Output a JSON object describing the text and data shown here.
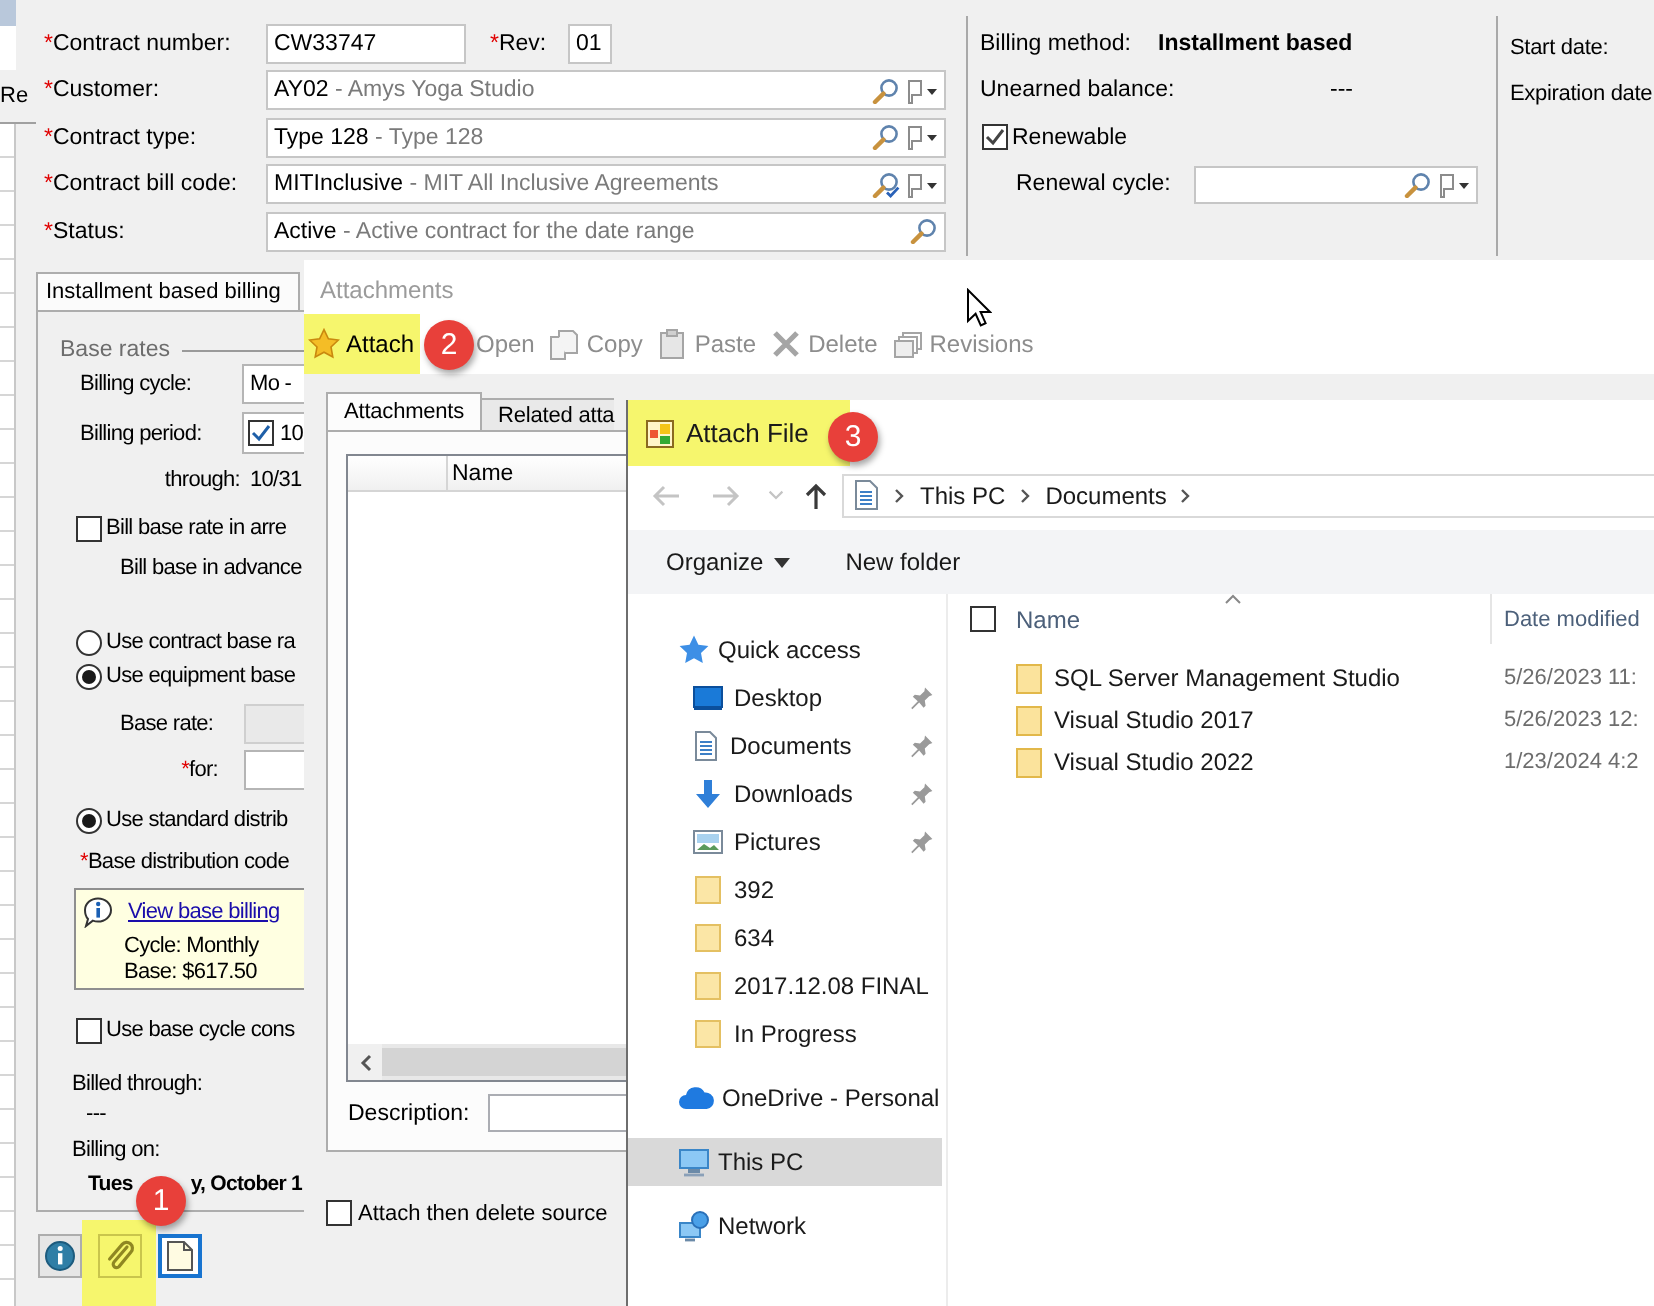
{
  "left_strip": {
    "label": "Re"
  },
  "contract": {
    "number": {
      "mark": "*",
      "label": "Contract number:",
      "value": "CW33747"
    },
    "rev": {
      "mark": "*",
      "label": "Rev:",
      "value": "01"
    },
    "lookup_fields": [
      {
        "mark": "*",
        "label": "Customer:",
        "code": "AY02",
        "description": "- Amys Yoga Studio",
        "validated": false,
        "flag_menu": true
      },
      {
        "mark": "*",
        "label": "Contract type:",
        "code": "Type 128",
        "description": "- Type 128",
        "validated": false,
        "flag_menu": true
      },
      {
        "mark": "*",
        "label": "Contract bill code:",
        "code": "MITInclusive",
        "description": "- MIT All Inclusive Agreements",
        "validated": true,
        "flag_menu": true
      },
      {
        "mark": "*",
        "label": "Status:",
        "code": "Active",
        "description": "- Active contract for the date range",
        "validated": false,
        "flag_menu": false
      }
    ]
  },
  "billing": {
    "method_label": "Billing method:",
    "method": "Installment based",
    "unearned_label": "Unearned balance:",
    "unearned": "---",
    "renewable": {
      "label": "Renewable",
      "checked": true
    },
    "renewal_cycle": {
      "label": "Renewal cycle:",
      "flag_menu": true
    }
  },
  "dates": {
    "start_label": "Start date:",
    "expiration_label": "Expiration date"
  },
  "billing_panel": {
    "tab": "Installment based billing",
    "group_title": "Base rates",
    "billing_cycle": {
      "label": "Billing cycle:",
      "value": "Mo -"
    },
    "billing_period": {
      "label": "Billing period:",
      "checked": true,
      "value": "10"
    },
    "through": {
      "label": "through:",
      "value": "10/31"
    },
    "bill_in_arrears": {
      "label": "Bill base rate in arre",
      "checked": false
    },
    "advance_note": "Bill base in advance",
    "rate_source": [
      {
        "label": "Use contract base ra",
        "selected": false
      },
      {
        "label": "Use equipment base",
        "selected": true
      }
    ],
    "base_rate": {
      "label": "Base rate:",
      "disabled": true
    },
    "rate_for": {
      "mark": "*",
      "label": "for:",
      "disabled": false
    },
    "standard_distribution": {
      "label": "Use standard distrib",
      "selected": true
    },
    "distribution_code": {
      "mark": "*",
      "label": "Base distribution code"
    },
    "info": {
      "link": "View base billing",
      "lines": [
        "Cycle: Monthly",
        "Base: $617.50"
      ]
    },
    "base_cycle": {
      "label": "Use base cycle cons",
      "checked": false
    },
    "billed_through": {
      "label": "Billed through:",
      "value": "---"
    },
    "billing_on": {
      "label": "Billing on:",
      "value_parts": [
        "Tues",
        "y, October 1"
      ]
    }
  },
  "bottom_buttons": [
    {
      "kind": "info",
      "focused": false
    },
    {
      "kind": "paperclip",
      "focused": false,
      "annotation": "1"
    },
    {
      "kind": "page",
      "focused": true
    }
  ],
  "attachments_dialog": {
    "title": "Attachments",
    "toolbar": [
      {
        "kind": "star",
        "label": "Attach",
        "disabled": false,
        "annotation": "2"
      },
      {
        "kind": "open",
        "label": "Open",
        "disabled": true
      },
      {
        "kind": "copy",
        "label": "Copy",
        "disabled": true
      },
      {
        "kind": "paste",
        "label": "Paste",
        "disabled": true
      },
      {
        "kind": "delete",
        "label": "Delete",
        "disabled": true
      },
      {
        "kind": "revisions",
        "label": "Revisions",
        "disabled": true
      }
    ],
    "tabs": [
      {
        "label": "Attachments",
        "selected": true
      },
      {
        "label": "Related atta",
        "selected": false
      }
    ],
    "list": {
      "columns": [
        "Name"
      ]
    },
    "description_label": "Description:",
    "delete_source": {
      "label": "Attach then delete source",
      "checked": false
    }
  },
  "attach_file_dialog": {
    "title": "Attach File",
    "annotation": "3",
    "nav_buttons": [
      {
        "kind": "back",
        "disabled": true
      },
      {
        "kind": "forward",
        "disabled": true
      },
      {
        "kind": "recent",
        "disabled": true
      },
      {
        "kind": "up",
        "disabled": false
      }
    ],
    "path": [
      "This PC",
      "Documents"
    ],
    "commands": [
      {
        "label": "Organize",
        "dropdown": true
      },
      {
        "label": "New folder",
        "dropdown": false
      }
    ],
    "nav": [
      {
        "label": "Quick access",
        "kind": "star",
        "selected": false,
        "children": [
          {
            "label": "Desktop",
            "kind": "desktop",
            "pinned": true,
            "selected": false
          },
          {
            "label": "Documents",
            "kind": "documents",
            "pinned": true,
            "selected": false
          },
          {
            "label": "Downloads",
            "kind": "downloads",
            "pinned": true,
            "selected": false
          },
          {
            "label": "Pictures",
            "kind": "pictures",
            "pinned": true,
            "selected": false
          },
          {
            "label": "392",
            "kind": "folder",
            "pinned": false,
            "selected": false
          },
          {
            "label": "634",
            "kind": "folder",
            "pinned": false,
            "selected": false
          },
          {
            "label": "2017.12.08 FINAL",
            "kind": "folder",
            "pinned": false,
            "selected": false
          },
          {
            "label": "In Progress",
            "kind": "folder",
            "pinned": false,
            "selected": false
          }
        ]
      },
      {
        "label": "OneDrive - Personal",
        "kind": "cloud",
        "selected": false
      },
      {
        "label": "This PC",
        "kind": "computer",
        "selected": true
      },
      {
        "label": "Network",
        "kind": "network",
        "selected": false
      }
    ],
    "select_all": {
      "checked": false
    },
    "columns": [
      {
        "label": "Name",
        "sorted": true
      },
      {
        "label": "Date modified",
        "sorted": false
      }
    ],
    "files": [
      {
        "name": "SQL Server Management Studio",
        "date": "5/26/2023 11:"
      },
      {
        "name": "Visual Studio 2017",
        "date": "5/26/2023 12:"
      },
      {
        "name": "Visual Studio 2022",
        "date": "1/23/2024 4:2"
      }
    ]
  }
}
